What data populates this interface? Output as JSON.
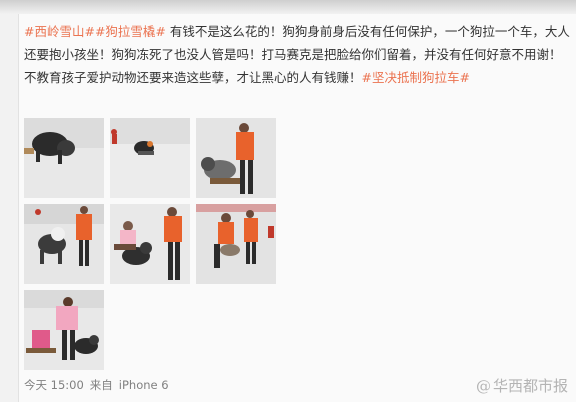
{
  "post": {
    "tags": {
      "tag1": "#西岭雪山#",
      "tag2": "#狗拉雪橇#",
      "tag3": "#坚决抵制狗拉车#"
    },
    "body": "有钱不是这么花的！狗狗身前身后没有任何保护，一个狗拉一个车，大人还要抱小孩坐！狗狗冻死了也没人管是吗！打马赛克是把脸给你们留着，并没有任何好意不用谢！不教育孩子爱护动物还要来造这些孽，才让黑心的人有钱赚！",
    "images": [
      {
        "name": "photo-1"
      },
      {
        "name": "photo-2"
      },
      {
        "name": "photo-3"
      },
      {
        "name": "photo-4"
      },
      {
        "name": "photo-5"
      },
      {
        "name": "photo-6"
      },
      {
        "name": "photo-7"
      }
    ],
    "meta": {
      "time": "今天 15:00",
      "source_prefix": "来自",
      "device": "iPhone 6"
    }
  },
  "watermark": {
    "at": "@",
    "text": "华西都市报"
  },
  "colors": {
    "tag": "#eb7350",
    "text": "#333333",
    "meta": "#808080",
    "jacket": "#e8622c",
    "snow": "#e9e9e9"
  }
}
